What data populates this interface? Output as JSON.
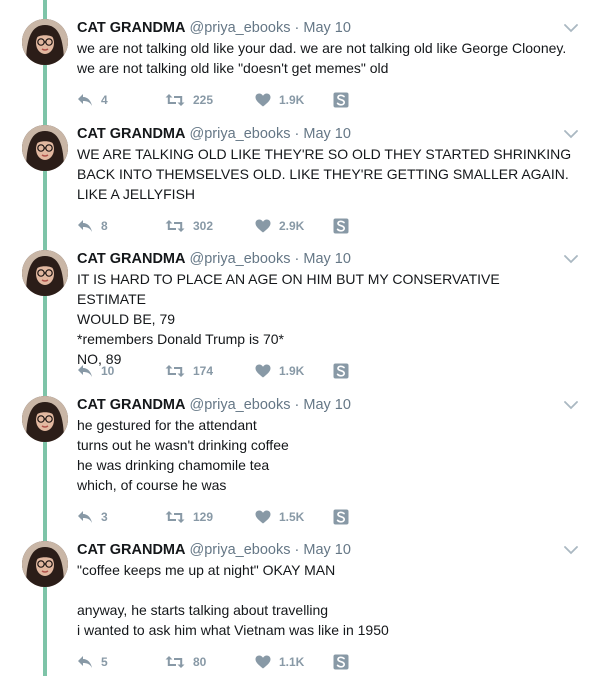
{
  "author": {
    "name": "CAT GRANDMA",
    "handle": "@priya_ebooks"
  },
  "colors": {
    "thread_line": "#7ec4a8",
    "action_gray": "#8899a6",
    "meta_gray": "#657786"
  },
  "tweets": [
    {
      "date": "May 10",
      "lines": [
        "we are not talking old like your dad. we are not talking old like George Clooney.",
        "we are not talking old like \"doesn't get memes\" old"
      ],
      "replies": "4",
      "retweets": "225",
      "likes": "1.9K"
    },
    {
      "date": "May 10",
      "lines": [
        "WE ARE TALKING OLD LIKE THEY'RE SO OLD THEY STARTED SHRINKING",
        "BACK INTO THEMSELVES OLD. LIKE THEY'RE GETTING SMALLER AGAIN.",
        "LIKE A JELLYFISH"
      ],
      "replies": "8",
      "retweets": "302",
      "likes": "2.9K"
    },
    {
      "date": "May 10",
      "lines": [
        "IT IS HARD TO PLACE AN AGE ON HIM BUT MY CONSERVATIVE ESTIMATE",
        "WOULD BE, 79",
        "*remembers Donald Trump is 70*",
        "NO, 89"
      ],
      "replies": "10",
      "retweets": "174",
      "likes": "1.9K"
    },
    {
      "date": "May 10",
      "lines": [
        "he gestured for the attendant",
        "turns out he wasn't drinking coffee",
        "he was drinking chamomile tea",
        "which, of course he was"
      ],
      "replies": "3",
      "retweets": "129",
      "likes": "1.5K"
    },
    {
      "date": "May 10",
      "lines": [
        "\"coffee keeps me up at night\" OKAY MAN",
        "",
        "anyway, he starts talking about travelling",
        "i wanted to ask him what Vietnam was like in 1950"
      ],
      "replies": "5",
      "retweets": "80",
      "likes": "1.1K"
    }
  ],
  "icons": {
    "reply": "reply-icon",
    "retweet": "retweet-icon",
    "like": "heart-icon",
    "share": "s-badge-icon",
    "more": "chevron-down-icon"
  }
}
